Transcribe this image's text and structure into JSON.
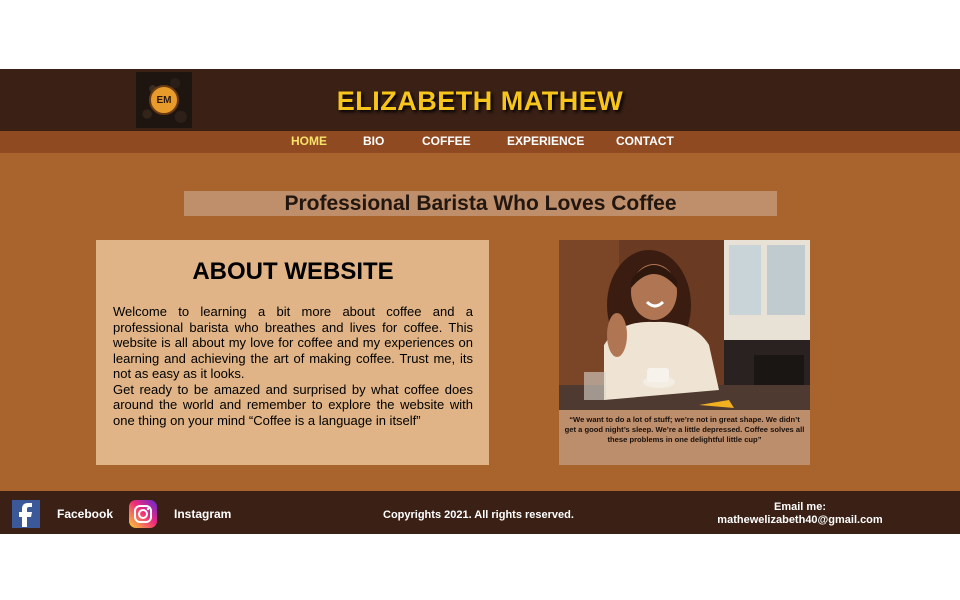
{
  "header": {
    "title": "ELIZABETH MATHEW",
    "logo_text": "EM"
  },
  "nav": {
    "items": [
      {
        "label": "HOME",
        "active": true
      },
      {
        "label": "BIO",
        "active": false
      },
      {
        "label": "COFFEE",
        "active": false
      },
      {
        "label": "EXPERIENCE",
        "active": false
      },
      {
        "label": "CONTACT",
        "active": false
      }
    ]
  },
  "main": {
    "tagline": "Professional Barista Who Loves Coffee",
    "about_heading": "ABOUT WEBSITE",
    "about_text": "Welcome to learning a bit more about coffee and a professional barista who breathes and lives for coffee. This website is all about my love for coffee and my experiences on learning and achieving the art of making coffee. Trust me, its not as easy as it looks.",
    "about_text_2": "Get ready to be amazed and surprised by what coffee does around the world and remember to explore the website with one thing on your mind “Coffee is a language in itself”",
    "photo_quote": "“We want to do a lot of stuff; we’re not in great shape. We didn’t get a good night’s sleep. We’re a little depressed. Coffee solves all these problems in one delightful little cup”"
  },
  "footer": {
    "facebook_label": "Facebook",
    "instagram_label": "Instagram",
    "copyright": "Copyrights 2021. All rights reserved.",
    "email_label": "Email me:",
    "email": "mathewelizabeth40@gmail.com"
  },
  "colors": {
    "header_bg": "#3a2015",
    "title": "#f8c61a",
    "nav_bg": "#8f4a22",
    "nav_active": "#f8e36a",
    "main_bg": "#a9642e",
    "about_box": "#e0b486"
  }
}
